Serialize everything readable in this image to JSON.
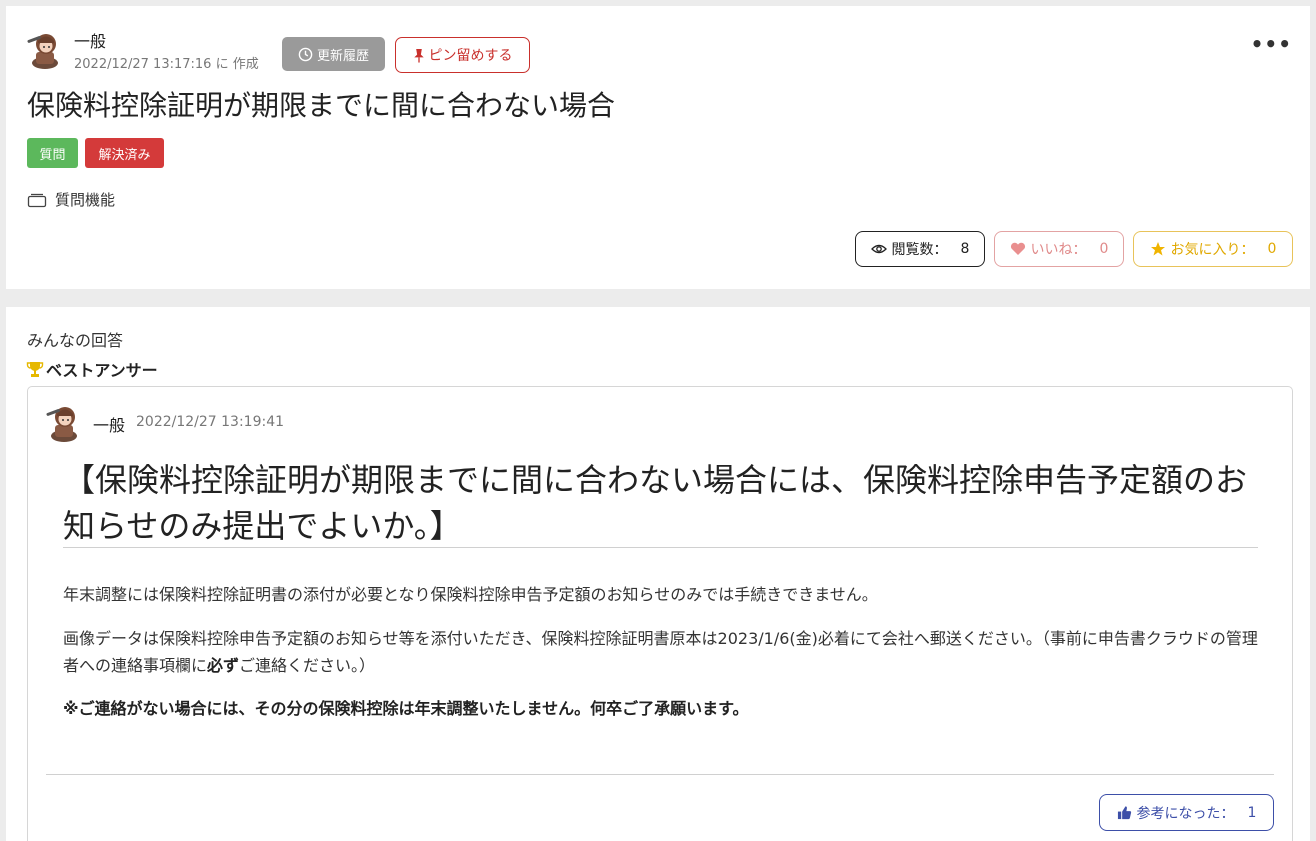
{
  "question": {
    "author": "一般",
    "created_at": "2022/12/27 13:17:16 に 作成",
    "history_label": "更新履歴",
    "pin_label": "ピン留めする",
    "more_label": "•••",
    "title": "保険料控除証明が期限までに間に合わない場合",
    "tags": [
      "質問",
      "解決済み"
    ],
    "category": "質問機能",
    "stats": {
      "views_label": "閲覧数：",
      "views_count": "8",
      "likes_label": "いいね：",
      "likes_count": "0",
      "favorites_label": "お気に入り：",
      "favorites_count": "0"
    }
  },
  "answers": {
    "section_label": "みんなの回答",
    "best_label": "ベストアンサー",
    "best": {
      "author": "一般",
      "timestamp": "2022/12/27 13:19:41",
      "heading": "【保険料控除証明が期限までに間に合わない場合には、保険料控除申告予定額のお知らせのみ提出でよいか。】",
      "paragraph1": "年末調整には保険料控除証明書の添付が必要となり保険料控除申告予定額のお知らせのみでは手続きできません。",
      "paragraph2_pre": "画像データは保険料控除申告予定額のお知らせ等を添付いただき、保険料控除証明書原本は2023/1/6(金)必着にて会社へ郵送ください。（事前に申告書クラウドの管理者への連絡事項欄に",
      "paragraph2_bold": "必ず",
      "paragraph2_post": "ご連絡ください。）",
      "paragraph3": "※ご連絡がない場合には、その分の保険料控除は年末調整いたしません。何卒ご了承願います。",
      "helpful_label": "参考になった：",
      "helpful_count": "1"
    }
  },
  "colors": {
    "tag_question": "#5cb85c",
    "tag_resolved": "#d43a3a",
    "pin": "#c9302c",
    "likes": "#e08a8a",
    "favorites": "#e0a800",
    "helpful": "#3d4fa8"
  }
}
